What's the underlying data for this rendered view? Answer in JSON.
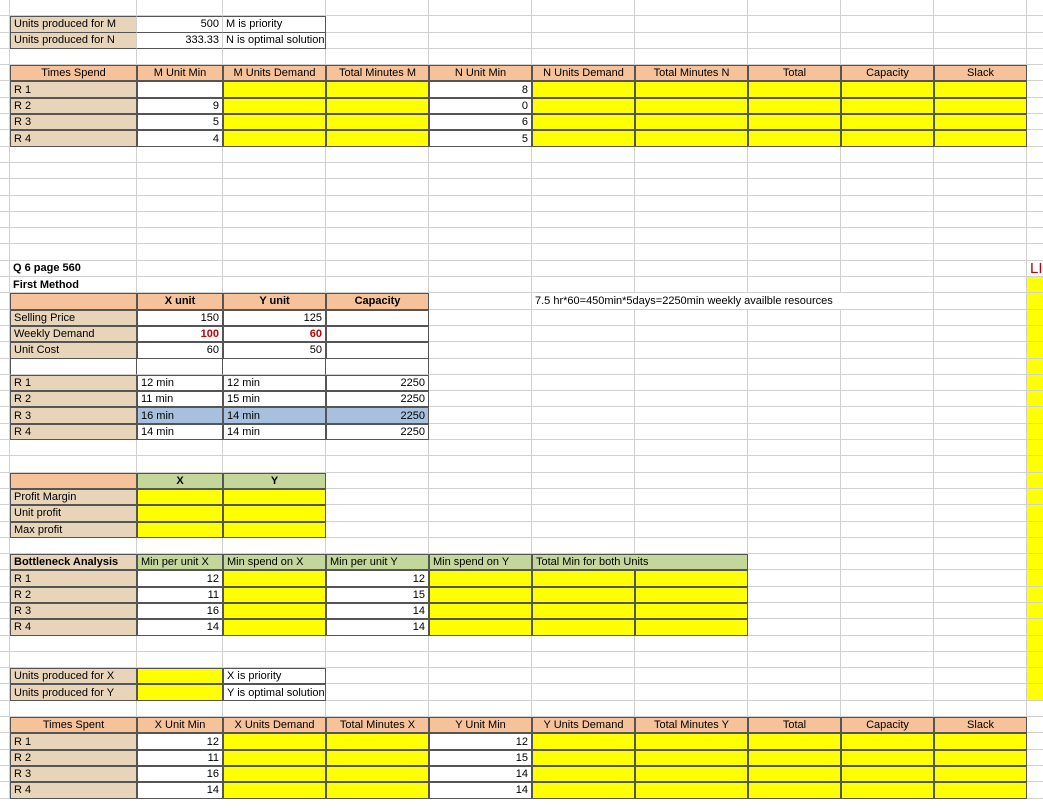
{
  "top": {
    "unitsM": {
      "label": "Units produced for M",
      "value": "500",
      "note": "M is priority"
    },
    "unitsN": {
      "label": "Units produced for N",
      "value": "333.33",
      "note": "N is optimal solution"
    }
  },
  "timesSpendHeaders": [
    "Times Spend",
    "M Unit Min",
    "M Units Demand",
    "Total Minutes M",
    "N Unit Min",
    "N Units Demand",
    "Total Minutes N",
    "Total",
    "Capacity",
    "Slack"
  ],
  "timesSpendRows": [
    {
      "r": "R 1",
      "m": "",
      "n": "8"
    },
    {
      "r": "R 2",
      "m": "9",
      "n": "0"
    },
    {
      "r": "R 3",
      "m": "5",
      "n": "6"
    },
    {
      "r": "R 4",
      "m": "4",
      "n": "5"
    }
  ],
  "q6": {
    "title": "Q 6 page 560",
    "method": "First Method"
  },
  "xyHeaders": [
    "X unit",
    "Y unit",
    "Capacity"
  ],
  "noteTxt": "7.5 hr*60=450min*5days=2250min weekly availble resources",
  "selling": {
    "label": "Selling Price",
    "x": "150",
    "y": "125"
  },
  "weekly": {
    "label": "Weekly Demand",
    "x": "100",
    "y": "60"
  },
  "unitcost": {
    "label": "Unit Cost",
    "x": "60",
    "y": "50"
  },
  "res": [
    {
      "r": "R 1",
      "x": "12 min",
      "y": "12 min",
      "c": "2250"
    },
    {
      "r": "R 2",
      "x": "11 min",
      "y": "15 min",
      "c": "2250"
    },
    {
      "r": "R 3",
      "x": "16 min",
      "y": "14 min",
      "c": "2250"
    },
    {
      "r": "R 4",
      "x": "14 min",
      "y": "14 min",
      "c": "2250"
    }
  ],
  "xy2Headers": [
    "X",
    "Y"
  ],
  "profitRows": [
    "Profit Margin",
    "Unit profit",
    "Max profit"
  ],
  "bottleneck": {
    "title": "Bottleneck Analysis",
    "headers": [
      "Min per unit X",
      "Min spend on X",
      "Min  per unit Y",
      "Min spend on Y",
      "Total  Min for both Units"
    ],
    "rows": [
      {
        "r": "R 1",
        "x": "12",
        "y": "12"
      },
      {
        "r": "R 2",
        "x": "11",
        "y": "15"
      },
      {
        "r": "R 3",
        "x": "16",
        "y": "14"
      },
      {
        "r": "R 4",
        "x": "14",
        "y": "14"
      }
    ]
  },
  "unitsX": {
    "label": "Units produced for X",
    "note": "X is priority"
  },
  "unitsY": {
    "label": "Units produced for Y",
    "note": "Y is optimal solution"
  },
  "timesSpentHeaders": [
    "Times Spent",
    "X Unit Min",
    "X Units Demand",
    "Total Minutes X",
    "Y Unit Min",
    "Y Units Demand",
    "Total Minutes Y",
    "Total",
    "Capacity",
    "Slack"
  ],
  "timesSpentRows": [
    {
      "r": "R 1",
      "x": "12",
      "y": "12"
    },
    {
      "r": "R 2",
      "x": "11",
      "y": "15"
    },
    {
      "r": "R 3",
      "x": "16",
      "y": "14"
    },
    {
      "r": "R 4",
      "x": "14",
      "y": "14"
    }
  ],
  "lindo": "LINDO Syntax a"
}
